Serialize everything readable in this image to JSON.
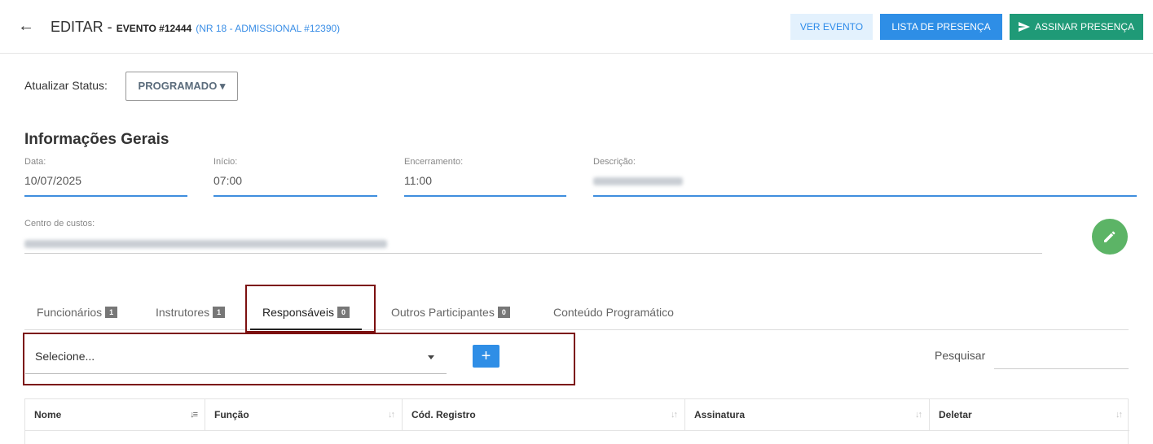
{
  "header": {
    "title": "EDITAR -",
    "event_label": "EVENTO #12444",
    "event_sub": "(NR 18 - ADMISSIONAL #12390)",
    "back_icon": "arrow-left-icon"
  },
  "actions": {
    "ver_evento": "VER EVENTO",
    "lista_presenca": "LISTA DE PRESENÇA",
    "assinar_presenca": "ASSINAR PRESENÇA",
    "assinar_icon": "send-icon"
  },
  "status": {
    "label": "Atualizar Status:",
    "value": "PROGRAMADO ▾"
  },
  "info": {
    "title": "Informações Gerais",
    "data_label": "Data:",
    "data_value": "10/07/2025",
    "inicio_label": "Início:",
    "inicio_value": "07:00",
    "encerramento_label": "Encerramento:",
    "encerramento_value": "11:00",
    "descricao_label": "Descrição:",
    "centro_label": "Centro de custos:",
    "edit_icon": "pencil-icon"
  },
  "tabs": [
    {
      "label": "Funcionários",
      "count": "1"
    },
    {
      "label": "Instrutores",
      "count": "1"
    },
    {
      "label": "Responsáveis",
      "count": "0"
    },
    {
      "label": "Outros Participantes",
      "count": "0"
    },
    {
      "label": "Conteúdo Programático"
    }
  ],
  "active_tab": "Responsáveis",
  "selector": {
    "placeholder": "Selecione...",
    "add_label": "+"
  },
  "search": {
    "label": "Pesquisar",
    "value": ""
  },
  "table": {
    "columns": [
      "Nome",
      "Função",
      "Cód. Registro",
      "Assinatura",
      "Deletar"
    ]
  },
  "colors": {
    "primary": "#2e8ee6",
    "success": "#1f9a77",
    "fab": "#5cb466",
    "highlight": "#7c1010"
  }
}
